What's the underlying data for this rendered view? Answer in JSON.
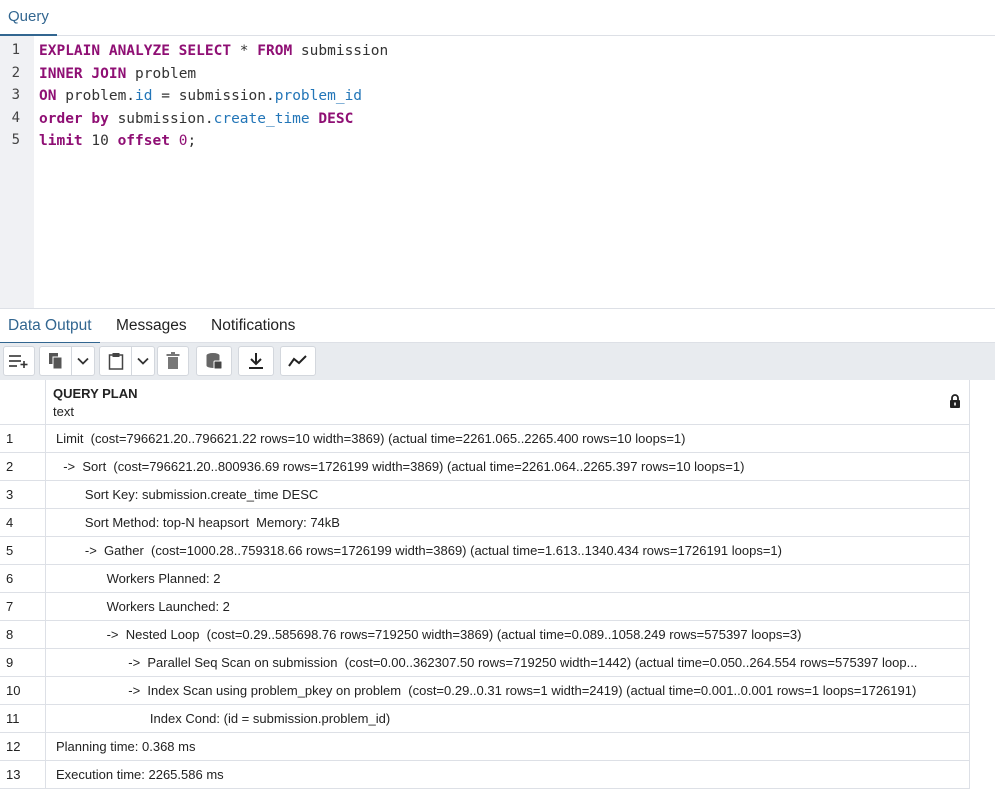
{
  "query_tab": {
    "label": "Query"
  },
  "editor": {
    "line_numbers": [
      "1",
      "2",
      "3",
      "4",
      "5"
    ],
    "lines": [
      [
        {
          "t": "EXPLAIN ANALYZE SELECT",
          "c": "kw"
        },
        {
          "t": " * ",
          "c": "plain"
        },
        {
          "t": "FROM",
          "c": "kw"
        },
        {
          "t": " submission",
          "c": "plain"
        }
      ],
      [
        {
          "t": "INNER JOIN",
          "c": "kw"
        },
        {
          "t": " problem",
          "c": "plain"
        }
      ],
      [
        {
          "t": "ON",
          "c": "kw"
        },
        {
          "t": " problem.",
          "c": "plain"
        },
        {
          "t": "id",
          "c": "col"
        },
        {
          "t": " = submission.",
          "c": "plain"
        },
        {
          "t": "problem_id",
          "c": "col"
        }
      ],
      [
        {
          "t": "order by",
          "c": "kw"
        },
        {
          "t": " submission.",
          "c": "plain"
        },
        {
          "t": "create_time",
          "c": "col"
        },
        {
          "t": " ",
          "c": "plain"
        },
        {
          "t": "DESC",
          "c": "kw"
        }
      ],
      [
        {
          "t": "limit",
          "c": "kw"
        },
        {
          "t": " 10 ",
          "c": "plain"
        },
        {
          "t": "offset",
          "c": "kw"
        },
        {
          "t": " ",
          "c": "plain"
        },
        {
          "t": "0",
          "c": "num"
        },
        {
          "t": ";",
          "c": "plain"
        }
      ]
    ]
  },
  "output_tabs": {
    "data_output": "Data Output",
    "messages": "Messages",
    "notifications": "Notifications"
  },
  "toolbar": {
    "icons": [
      "add-row-icon",
      "copy-icon",
      "chevron-down-icon",
      "paste-icon",
      "chevron-down-icon",
      "delete-icon",
      "save-data-icon",
      "download-icon",
      "graph-icon"
    ]
  },
  "grid": {
    "column_name": "QUERY PLAN",
    "column_type": "text",
    "rows": [
      {
        "n": "1",
        "text": "Limit  (cost=796621.20..796621.22 rows=10 width=3869) (actual time=2261.065..2265.400 rows=10 loops=1)"
      },
      {
        "n": "2",
        "text": "  ->  Sort  (cost=796621.20..800936.69 rows=1726199 width=3869) (actual time=2261.064..2265.397 rows=10 loops=1)"
      },
      {
        "n": "3",
        "text": "        Sort Key: submission.create_time DESC"
      },
      {
        "n": "4",
        "text": "        Sort Method: top-N heapsort  Memory: 74kB"
      },
      {
        "n": "5",
        "text": "        ->  Gather  (cost=1000.28..759318.66 rows=1726199 width=3869) (actual time=1.613..1340.434 rows=1726191 loops=1)"
      },
      {
        "n": "6",
        "text": "              Workers Planned: 2"
      },
      {
        "n": "7",
        "text": "              Workers Launched: 2"
      },
      {
        "n": "8",
        "text": "              ->  Nested Loop  (cost=0.29..585698.76 rows=719250 width=3869) (actual time=0.089..1058.249 rows=575397 loops=3)"
      },
      {
        "n": "9",
        "text": "                    ->  Parallel Seq Scan on submission  (cost=0.00..362307.50 rows=719250 width=1442) (actual time=0.050..264.554 rows=575397 loop..."
      },
      {
        "n": "10",
        "text": "                    ->  Index Scan using problem_pkey on problem  (cost=0.29..0.31 rows=1 width=2419) (actual time=0.001..0.001 rows=1 loops=1726191)"
      },
      {
        "n": "11",
        "text": "                          Index Cond: (id = submission.problem_id)"
      },
      {
        "n": "12",
        "text": "Planning time: 0.368 ms"
      },
      {
        "n": "13",
        "text": "Execution time: 2265.586 ms"
      }
    ]
  },
  "colors": {
    "accent": "#326690",
    "keyword": "#8f0f74",
    "identifier": "#2376b8",
    "toolbar_bg": "#e8ebef",
    "gutter_bg": "#f0f1f4"
  }
}
